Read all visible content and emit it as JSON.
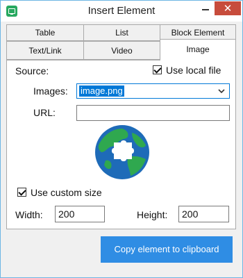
{
  "window": {
    "title": "Insert Element"
  },
  "titlebar": {
    "close_glyph": "✕"
  },
  "tabs": {
    "row_back": [
      "Table",
      "List",
      "Block Element"
    ],
    "row_front": [
      "Text/Link",
      "Video",
      "Image"
    ],
    "active": "Image"
  },
  "image_tab": {
    "source_label": "Source:",
    "use_local_file_label": "Use local file",
    "use_local_file_checked": true,
    "images_label": "Images:",
    "images_value": "image.png",
    "url_label": "URL:",
    "url_value": "",
    "use_custom_size_label": "Use custom size",
    "use_custom_size_checked": true,
    "width_label": "Width:",
    "width_value": "200",
    "height_label": "Height:",
    "height_value": "200",
    "preview_icon": "globe-puzzle-icon"
  },
  "copy_button_label": "Copy element to clipboard",
  "colors": {
    "accent": "#2f8de4",
    "close": "#c74c3c",
    "app_icon": "#27a85f",
    "globe_ocean": "#1e6bb8",
    "globe_land": "#2fa84f"
  }
}
